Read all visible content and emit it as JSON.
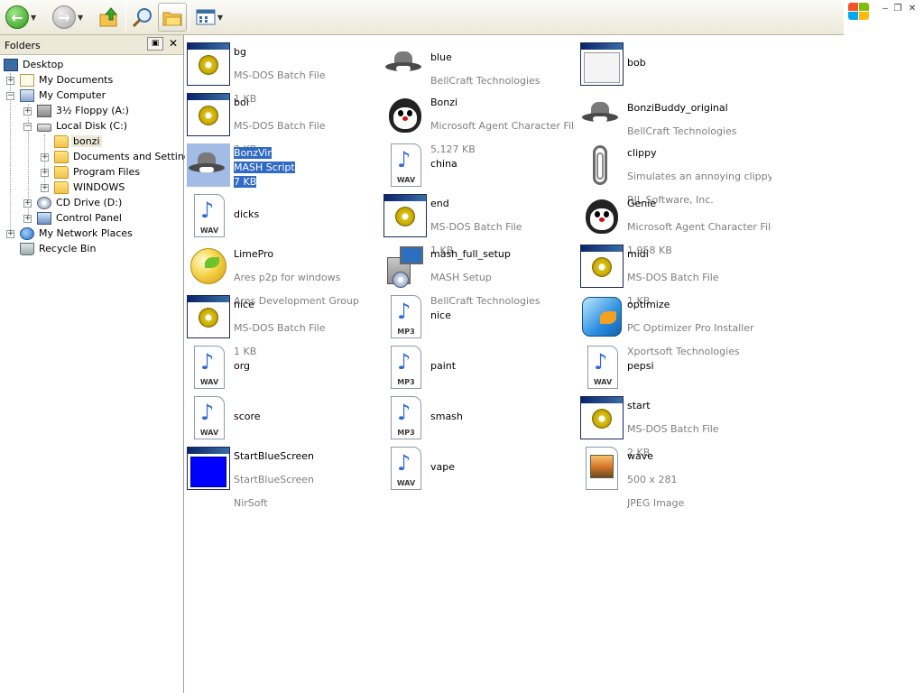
{
  "folders_pane": {
    "title": "Folders",
    "pin_icon": "pin-icon",
    "close_glyph": "✕",
    "tree": [
      {
        "label": "Desktop",
        "icon": "desktop-icon"
      },
      {
        "label": "My Documents",
        "icon": "my-documents-icon"
      },
      {
        "label": "My Computer",
        "icon": "my-computer-icon"
      },
      {
        "label": "3½ Floppy (A:)",
        "icon": "floppy-icon"
      },
      {
        "label": "Local Disk (C:)",
        "icon": "hard-disk-icon"
      },
      {
        "label": "bonzi",
        "icon": "folder-icon"
      },
      {
        "label": "Documents and Settings",
        "icon": "folder-icon"
      },
      {
        "label": "Program Files",
        "icon": "folder-icon"
      },
      {
        "label": "WINDOWS",
        "icon": "folder-icon"
      },
      {
        "label": "CD Drive (D:)",
        "icon": "cd-drive-icon"
      },
      {
        "label": "Control Panel",
        "icon": "control-panel-icon"
      },
      {
        "label": "My Network Places",
        "icon": "network-places-icon"
      },
      {
        "label": "Recycle Bin",
        "icon": "recycle-bin-icon"
      }
    ]
  },
  "files": [
    {
      "name": "bg",
      "line2": "MS-DOS Batch File",
      "line3": "1 KB",
      "icon": "batch-file-icon"
    },
    {
      "name": "blue",
      "line2": "BellCraft Technologies",
      "line3": "",
      "icon": "hat-icon"
    },
    {
      "name": "bob",
      "line2": "",
      "line3": "",
      "icon": "window-icon"
    },
    {
      "name": "boi",
      "line2": "MS-DOS Batch File",
      "line3": "2 KB",
      "icon": "batch-file-icon"
    },
    {
      "name": "Bonzi",
      "line2": "Microsoft Agent Character File",
      "line3": "5,127 KB",
      "icon": "agent-character-icon"
    },
    {
      "name": "BonziBuddy_original",
      "line2": "BellCraft Technologies",
      "line3": "",
      "icon": "hat-icon"
    },
    {
      "name": "BonzVir",
      "line2": "MASH Script",
      "line3": "7 KB",
      "icon": "hat-icon"
    },
    {
      "name": "china",
      "line2": "",
      "line3": "",
      "icon": "wav-file-icon"
    },
    {
      "name": "clippy",
      "line2": "Simulates an annoying clippy h...",
      "line3": "RJL Software, Inc.",
      "icon": "paperclip-icon"
    },
    {
      "name": "dicks",
      "line2": "",
      "line3": "",
      "icon": "wav-file-icon"
    },
    {
      "name": "end",
      "line2": "MS-DOS Batch File",
      "line3": "1 KB",
      "icon": "batch-file-icon"
    },
    {
      "name": "Genie",
      "line2": "Microsoft Agent Character File",
      "line3": "1,958 KB",
      "icon": "agent-character-icon"
    },
    {
      "name": "LimePro",
      "line2": "Ares p2p for windows",
      "line3": "Ares Development Group",
      "icon": "limepro-icon"
    },
    {
      "name": "mash_full_setup",
      "line2": "MASH Setup",
      "line3": "BellCraft Technologies",
      "icon": "setup-icon"
    },
    {
      "name": "midi",
      "line2": "MS-DOS Batch File",
      "line3": "1 KB",
      "icon": "batch-file-icon"
    },
    {
      "name": "nice",
      "line2": "MS-DOS Batch File",
      "line3": "1 KB",
      "icon": "batch-file-icon"
    },
    {
      "name": "nice",
      "line2": "",
      "line3": "",
      "icon": "mp3-file-icon"
    },
    {
      "name": "optimize",
      "line2": "PC Optimizer Pro Installer",
      "line3": "Xportsoft Technologies",
      "icon": "optimizer-icon"
    },
    {
      "name": "org",
      "line2": "",
      "line3": "",
      "icon": "wav-file-icon"
    },
    {
      "name": "paint",
      "line2": "",
      "line3": "",
      "icon": "mp3-file-icon"
    },
    {
      "name": "pepsi",
      "line2": "",
      "line3": "",
      "icon": "wav-file-icon"
    },
    {
      "name": "score",
      "line2": "",
      "line3": "",
      "icon": "wav-file-icon"
    },
    {
      "name": "smash",
      "line2": "",
      "line3": "",
      "icon": "mp3-file-icon"
    },
    {
      "name": "start",
      "line2": "MS-DOS Batch File",
      "line3": "2 KB",
      "icon": "batch-file-icon"
    },
    {
      "name": "StartBlueScreen",
      "line2": "StartBlueScreen",
      "line3": "NirSoft",
      "icon": "bluescreen-icon"
    },
    {
      "name": "vape",
      "line2": "",
      "line3": "",
      "icon": "wav-file-icon"
    },
    {
      "name": "wave",
      "line2": "500 x 281",
      "line3": "JPEG Image",
      "icon": "jpeg-file-icon"
    }
  ],
  "audio_tags": {
    "wav": "WAV",
    "mp3": "MP3"
  },
  "selected_file": "BonzVir",
  "colors": {
    "selection": "#316ac5",
    "subtext": "#7f7f7f",
    "toolbar": "#ece9d8"
  }
}
